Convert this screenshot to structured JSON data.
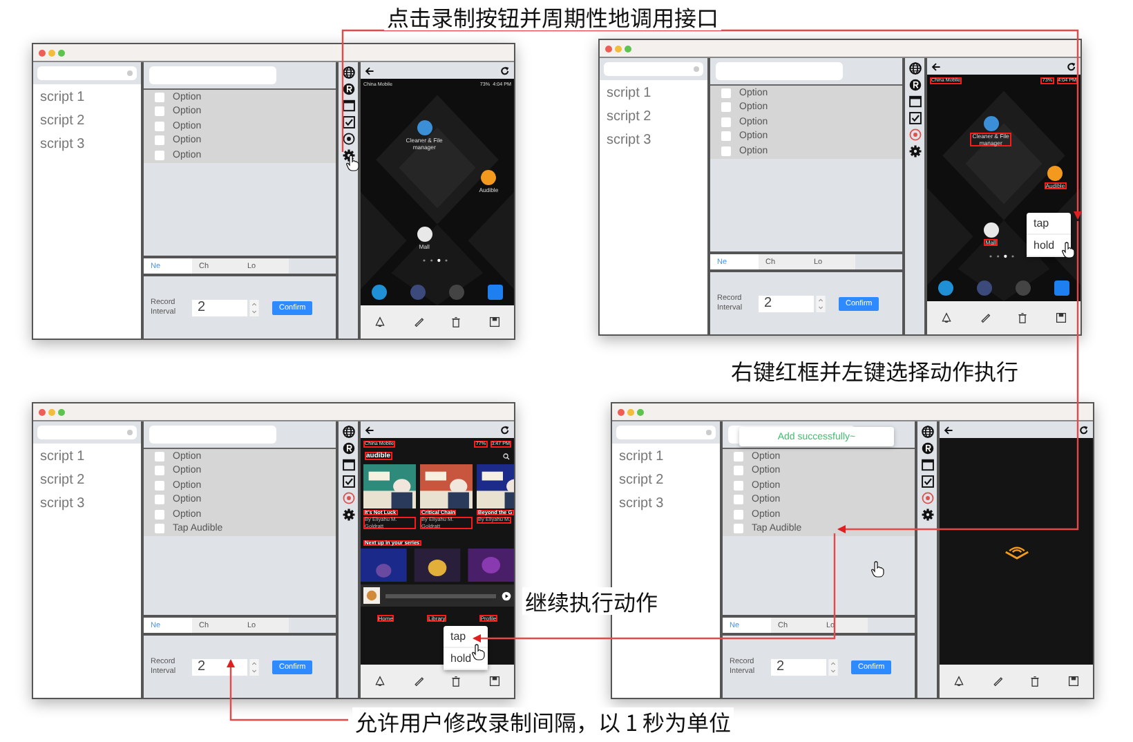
{
  "captions": [
    "点击录制按钮并周期性地调用接口",
    "右键红框并左键选择动作执行",
    "继续执行动作",
    "允许用户修改录制间隔，以 1 秒为单位"
  ],
  "panels": [
    {
      "scripts": [
        "script 1",
        "script 2",
        "script 3"
      ],
      "options": [
        {
          "label": "Option",
          "checked": false
        },
        {
          "label": "Option",
          "checked": false
        },
        {
          "label": "Option",
          "checked": false
        },
        {
          "label": "Option",
          "checked": false
        },
        {
          "label": "Option",
          "checked": false
        }
      ],
      "tabs": [
        {
          "label": "Ne",
          "selected": true
        },
        {
          "label": "Ch",
          "selected": false
        },
        {
          "label": "Lo",
          "selected": false
        }
      ],
      "interval_label": "Record Interval",
      "interval": "2",
      "confirm": "Confirm",
      "recording": false,
      "phone": {
        "kind": "home",
        "highlighted": false,
        "carrier": "China Mobile",
        "battery": "73%",
        "time": "4:04 PM",
        "apps": [
          "Cleaner & File manager",
          "Audible",
          "Mall"
        ]
      }
    },
    {
      "scripts": [
        "script 1",
        "script 2",
        "script 3"
      ],
      "options": [
        {
          "label": "Option",
          "checked": false
        },
        {
          "label": "Option",
          "checked": false
        },
        {
          "label": "Option",
          "checked": false
        },
        {
          "label": "Option",
          "checked": false
        },
        {
          "label": "Option",
          "checked": false
        }
      ],
      "tabs": [
        {
          "label": "Ne",
          "selected": true
        },
        {
          "label": "Ch",
          "selected": false
        },
        {
          "label": "Lo",
          "selected": false
        }
      ],
      "interval_label": "Record Interval",
      "interval": "2",
      "confirm": "Confirm",
      "recording": true,
      "menu": [
        "tap",
        "hold"
      ],
      "phone": {
        "kind": "home",
        "highlighted": true,
        "carrier": "China Mobile",
        "battery": "73%",
        "time": "4:04 PM",
        "apps": [
          "Cleaner & File manager",
          "Audible",
          "Mall"
        ]
      }
    },
    {
      "scripts": [
        "script 1",
        "script 2",
        "script 3"
      ],
      "options": [
        {
          "label": "Option",
          "checked": false
        },
        {
          "label": "Option",
          "checked": false
        },
        {
          "label": "Option",
          "checked": false
        },
        {
          "label": "Option",
          "checked": false
        },
        {
          "label": "Option",
          "checked": false
        },
        {
          "label": "Tap Audible",
          "checked": false
        }
      ],
      "tabs": [
        {
          "label": "Ne",
          "selected": true
        },
        {
          "label": "Ch",
          "selected": false
        },
        {
          "label": "Lo",
          "selected": false
        }
      ],
      "interval_label": "Record Interval",
      "interval": "2",
      "confirm": "Confirm",
      "recording": true,
      "menu": [
        "tap",
        "hold"
      ],
      "phone": {
        "kind": "audible",
        "highlighted": true,
        "carrier": "China Mobile",
        "battery": "77%",
        "time": "3:47 PM",
        "brand": "audible",
        "books": [
          {
            "title": "It's Not Luck",
            "author": "By Eliyahu M. Goldratt"
          },
          {
            "title": "Critical Chain",
            "author": "By Eliyahu M. Goldratt"
          },
          {
            "title": "Beyond the G",
            "author": "By Eliyahu M."
          }
        ],
        "section": "Next up in your series",
        "nav": [
          "Home",
          "Library",
          "Profile"
        ]
      }
    },
    {
      "scripts": [
        "script 1",
        "script 2",
        "script 3"
      ],
      "options": [
        {
          "label": "Option",
          "checked": false
        },
        {
          "label": "Option",
          "checked": false
        },
        {
          "label": "Option",
          "checked": false
        },
        {
          "label": "Option",
          "checked": false
        },
        {
          "label": "Option",
          "checked": false
        },
        {
          "label": "Tap Audible",
          "checked": false
        }
      ],
      "tabs": [
        {
          "label": "Ne",
          "selected": true
        },
        {
          "label": "Ch",
          "selected": false
        },
        {
          "label": "Lo",
          "selected": false
        }
      ],
      "interval_label": "Record Interval",
      "interval": "2",
      "confirm": "Confirm",
      "recording": true,
      "toast": "Add successfully~",
      "phone": {
        "kind": "splash"
      }
    }
  ]
}
